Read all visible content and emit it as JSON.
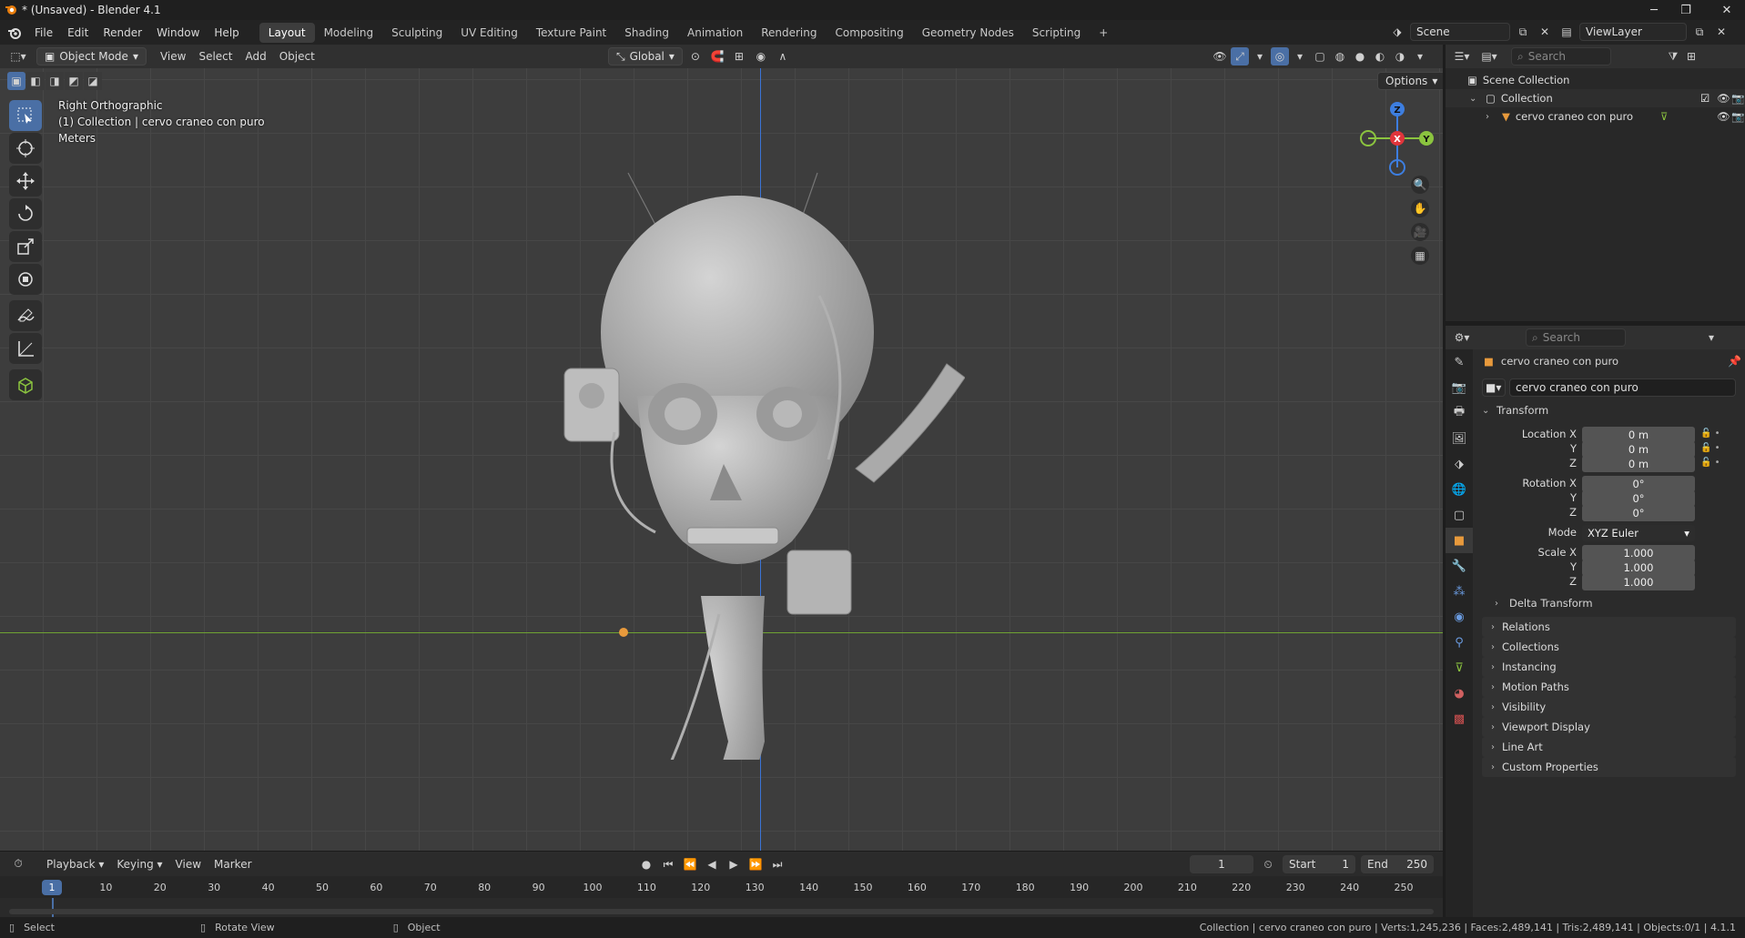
{
  "window": {
    "title": "* (Unsaved) - Blender 4.1"
  },
  "menus": [
    "File",
    "Edit",
    "Render",
    "Window",
    "Help"
  ],
  "workspaces": [
    {
      "label": "Layout",
      "active": true
    },
    {
      "label": "Modeling"
    },
    {
      "label": "Sculpting"
    },
    {
      "label": "UV Editing"
    },
    {
      "label": "Texture Paint"
    },
    {
      "label": "Shading"
    },
    {
      "label": "Animation"
    },
    {
      "label": "Rendering"
    },
    {
      "label": "Compositing"
    },
    {
      "label": "Geometry Nodes"
    },
    {
      "label": "Scripting"
    }
  ],
  "scene": {
    "name": "Scene"
  },
  "view_layer": {
    "name": "ViewLayer"
  },
  "viewport_header": {
    "mode": "Object Mode",
    "menus": [
      "View",
      "Select",
      "Add",
      "Object"
    ],
    "transform_orientation": "Global",
    "options_label": "Options"
  },
  "viewport": {
    "overlay": [
      "Right Orthographic",
      "(1) Collection | cervo craneo con puro",
      "Meters"
    ],
    "gizmo": {
      "z": "Z",
      "x": "X",
      "y": "Y"
    }
  },
  "outliner": {
    "search_placeholder": "Search",
    "rows": [
      "Scene Collection",
      "Collection",
      "cervo craneo con puro"
    ]
  },
  "properties": {
    "search_placeholder": "Search",
    "object_name": "cervo craneo con puro",
    "datablock_name": "cervo craneo con puro",
    "transform_label": "Transform",
    "location_label": "Location X",
    "rotation_label": "Rotation X",
    "scale_label": "Scale X",
    "axis_y": "Y",
    "axis_z": "Z",
    "location": [
      "0 m",
      "0 m",
      "0 m"
    ],
    "rotation": [
      "0°",
      "0°",
      "0°"
    ],
    "mode_label": "Mode",
    "mode_value": "XYZ Euler",
    "scale": [
      "1.000",
      "1.000",
      "1.000"
    ],
    "delta_transform": "Delta Transform",
    "panels": [
      "Relations",
      "Collections",
      "Instancing",
      "Motion Paths",
      "Visibility",
      "Viewport Display",
      "Line Art",
      "Custom Properties"
    ]
  },
  "timeline": {
    "menus": [
      "Playback",
      "Keying",
      "View",
      "Marker"
    ],
    "current_frame": "1",
    "start_label": "Start",
    "start": "1",
    "end_label": "End",
    "end": "250",
    "ticks": [
      "1",
      "10",
      "20",
      "30",
      "40",
      "50",
      "60",
      "70",
      "80",
      "90",
      "100",
      "110",
      "120",
      "130",
      "140",
      "150",
      "160",
      "170",
      "180",
      "190",
      "200",
      "210",
      "220",
      "230",
      "240",
      "250"
    ]
  },
  "status": {
    "select": "Select",
    "rotate": "Rotate View",
    "object": "Object",
    "info": "Collection | cervo craneo con puro | Verts:1,245,236 | Faces:2,489,141 | Tris:2,489,141 | Objects:0/1 | 4.1.1"
  },
  "colors": {
    "accent": "#4a6fa5",
    "x_axis": "#e0353b",
    "y_axis": "#8bc43f",
    "z_axis": "#3d7ee0",
    "object_orange": "#e89a3c"
  }
}
